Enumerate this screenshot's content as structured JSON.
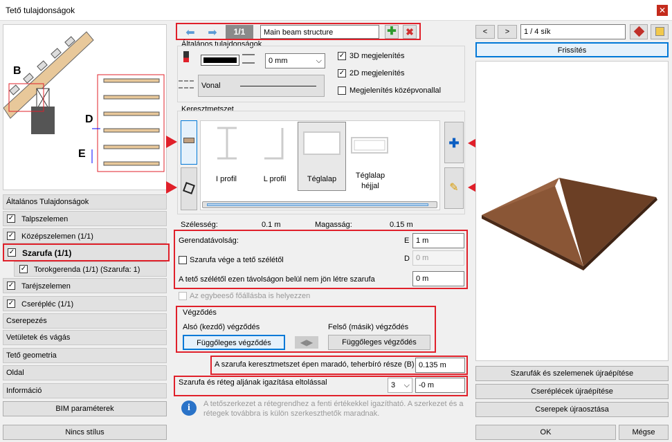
{
  "window": {
    "title": "Tető tulajdonságok",
    "close_icon": "close-icon"
  },
  "left": {
    "general_header": "Általános Tulajdonságok",
    "items": [
      {
        "label": "Talpszelemen",
        "checked": true
      },
      {
        "label": "Középszelemen (1/1)",
        "checked": true
      },
      {
        "label": "Szarufa (1/1)",
        "checked": true
      },
      {
        "label": "Torokgerenda (1/1) (Szarufa: 1)",
        "checked": true
      },
      {
        "label": "Taréjszelemen",
        "checked": true
      },
      {
        "label": "Cserépléc (1/1)",
        "checked": true
      }
    ],
    "sections": [
      "Cserepezés",
      "Vetületek és vágás",
      "Tető geometria",
      "Oldal",
      "Információ"
    ],
    "bim_button": "BIM paraméterek",
    "style_button": "Nincs stílus",
    "diagram_labels": {
      "b": "B",
      "d": "D",
      "e": "E"
    }
  },
  "center": {
    "counter": "1/1",
    "name_value": "Main beam structure",
    "general_title": "Általános tulajdonságok",
    "pen_value": "0 mm",
    "line_label": "Vonal",
    "check_3d": {
      "label": "3D megjelenítés",
      "checked": true
    },
    "check_2d": {
      "label": "2D megjelenítés",
      "checked": true
    },
    "check_center": {
      "label": "Megjelenítés középvonallal",
      "checked": false
    },
    "cross_title": "Keresztmetszet",
    "profiles": [
      {
        "label": "I profil",
        "selected": false
      },
      {
        "label": "L profil",
        "selected": false
      },
      {
        "label": "Téglalap",
        "selected": true
      },
      {
        "label": "Téglalap\nhéjjal",
        "selected": false
      }
    ],
    "width_label": "Szélesség:",
    "width_value": "0.1 m",
    "height_label": "Magasság:",
    "height_value": "0.15 m",
    "spacing_label": "Gerendatávolság:",
    "spacing_key": "E",
    "spacing_value": "1 m",
    "edge_check": {
      "label": "Szarufa vége a tető szélétől",
      "checked": false
    },
    "edge_key": "D",
    "edge_value": "0 m",
    "no_rafter_label": "A tető szélétől ezen távolságon belül nem jön létre szarufa",
    "no_rafter_value": "0 m",
    "main_slope_check": "Az egybeeső főállásba is helyezzen",
    "ending_title": "Végződés",
    "lower_label": "Alsó (kezdő) végződés",
    "lower_button": "Függőleges végződés",
    "upper_label": "Felső (másik) végződés",
    "upper_button": "Függőleges végződés",
    "remaining_label": "A szarufa keresztmetszet épen maradó, teherbíró része (B)",
    "remaining_value": "0.135 m",
    "align_label": "Szarufa és réteg aljának igazítása eltolással",
    "align_select": "3",
    "align_value": "-0 m",
    "info_text": "A tetőszerkezet a rétegrendhez a fenti értékekkel igazítható. A szerkezet és a rétegek továbbra is külön szerkeszthetők maradnak."
  },
  "right": {
    "prev": "<",
    "next": ">",
    "plane": "1 / 4 sík",
    "refresh": "Frissítés",
    "rebuild_rafters": "Szarufák és szelemenek újraépítése",
    "rebuild_battens": "Cseréplécek újraépítése",
    "redistribute_tiles": "Cserepek újraosztása"
  },
  "footer": {
    "ok": "OK",
    "cancel": "Mégse"
  },
  "colors": {
    "red_highlight": "#e0202a",
    "accent": "#0078d7",
    "roof": "#7a4a2f"
  }
}
